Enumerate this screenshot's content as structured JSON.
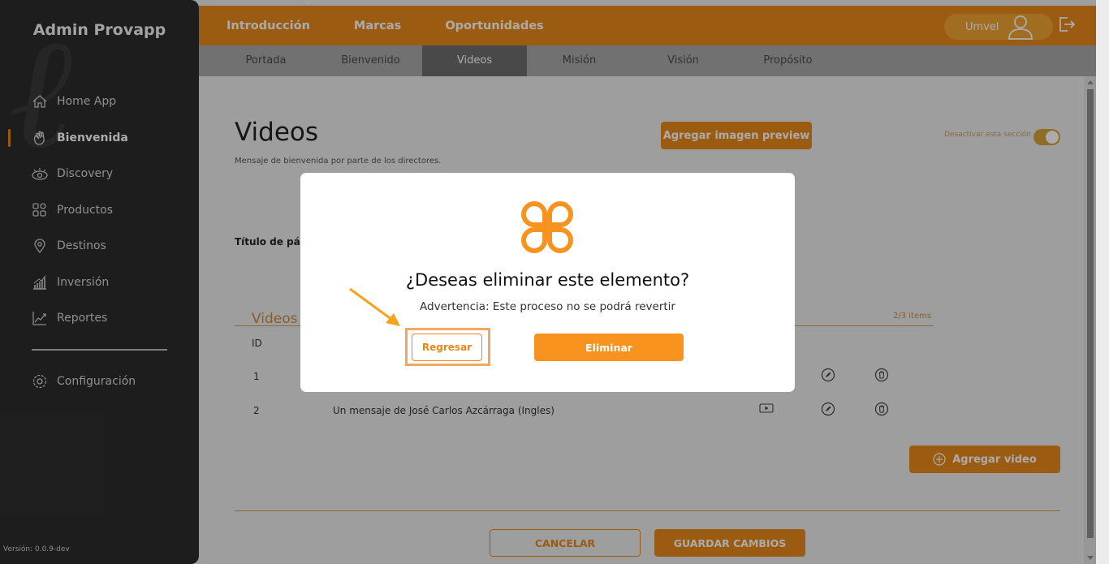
{
  "sidebar": {
    "brand": "Admin Provapp",
    "items": [
      {
        "label": "Home App",
        "icon": "home-icon"
      },
      {
        "label": "Bienvenida",
        "icon": "waving-hand-icon",
        "active": true
      },
      {
        "label": "Discovery",
        "icon": "eye-icon"
      },
      {
        "label": "Productos",
        "icon": "grid-icon"
      },
      {
        "label": "Destinos",
        "icon": "location-pin-icon"
      },
      {
        "label": "Inversión",
        "icon": "bar-chart-icon"
      },
      {
        "label": "Reportes",
        "icon": "line-chart-icon"
      }
    ],
    "config_label": "Configuración",
    "version": "Versión: 0.0.9-dev"
  },
  "topbar": {
    "nav": [
      "Introducción",
      "Marcas",
      "Oportunidades"
    ],
    "user_name": "Umvel"
  },
  "subnav": {
    "tabs": [
      "Portada",
      "Bienvenido",
      "Videos",
      "Misión",
      "Visión",
      "Propósito"
    ],
    "active": "Videos"
  },
  "page": {
    "title": "Videos",
    "subtitle": "Mensaje de bienvenida por parte de los directores.",
    "add_preview_button": "Agregar imagen preview",
    "toggle_label": "Desactivar esta sección",
    "field_label": "Título de págı",
    "list_title": "Videos",
    "list_count": "2/3 items",
    "col_id": "ID",
    "rows": [
      {
        "id": "1",
        "title": ""
      },
      {
        "id": "2",
        "title": "Un mensaje de José Carlos Azcárraga (Ingles)"
      }
    ],
    "add_video_button": "Agregar video",
    "cancel_button": "CANCELAR",
    "save_button": "GUARDAR CAMBIOS"
  },
  "modal": {
    "question": "¿Deseas eliminar este elemento?",
    "warning": "Advertencia: Este proceso no se podrá revertir",
    "back_button": "Regresar",
    "delete_button": "Eliminar"
  },
  "colors": {
    "accent": "#e8891c",
    "sidebar": "#2c2c2c",
    "highlight": "#f0a860"
  }
}
